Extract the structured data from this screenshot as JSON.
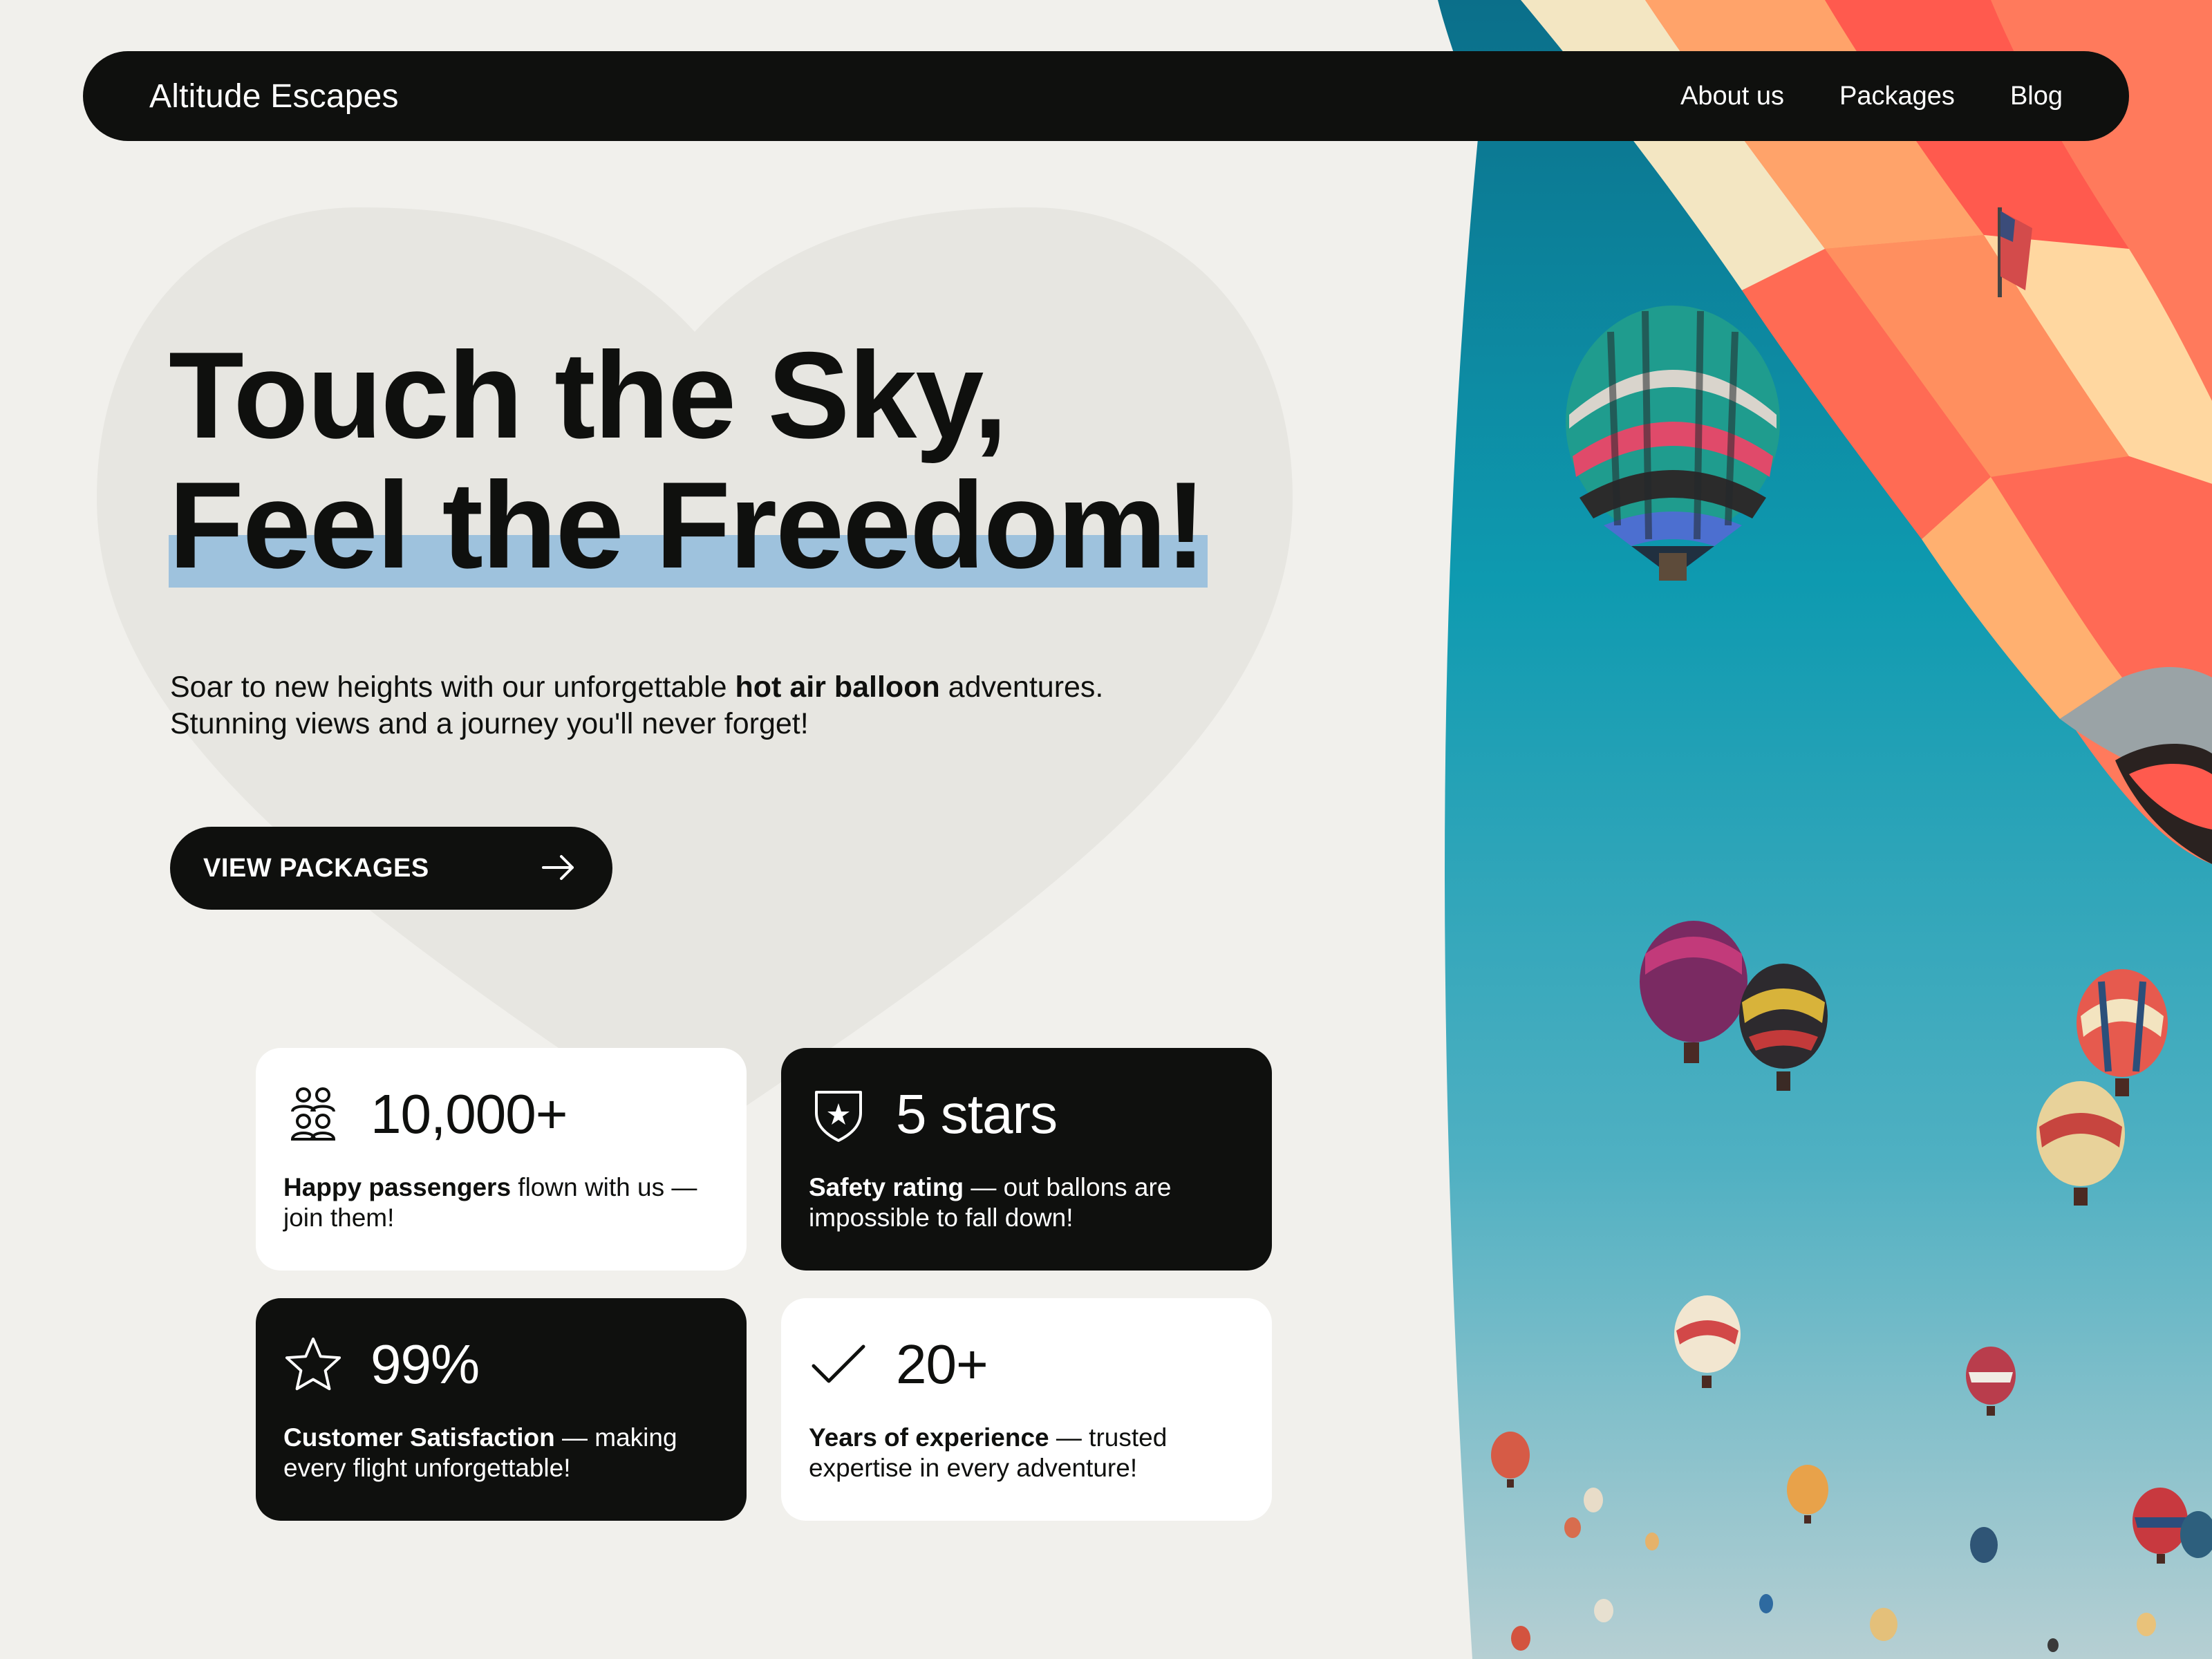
{
  "nav": {
    "brand": "Altitude Escapes",
    "links": [
      "About us",
      "Packages",
      "Blog"
    ]
  },
  "hero": {
    "headline_line1": "Touch the Sky,",
    "headline_line2": "Feel the Freedom!",
    "sub_part1": "Soar to new heights with our unforgettable ",
    "sub_bold": "hot air balloon",
    "sub_part2": " adventures.",
    "sub_line2": "Stunning views and a journey you'll never forget!",
    "cta_label": "VIEW PACKAGES"
  },
  "stats": [
    {
      "icon": "people-icon",
      "value": "10,000+",
      "bold": "Happy passengers",
      "rest": " flown with us — join them!",
      "theme": "light"
    },
    {
      "icon": "shield-star-icon",
      "value": "5 stars",
      "bold": "Safety rating",
      "rest": " — out ballons are impossible to fall down!",
      "theme": "dark"
    },
    {
      "icon": "star-icon",
      "value": "99%",
      "bold": "Customer Satisfaction",
      "rest": " — making every flight unforgettable!",
      "theme": "dark"
    },
    {
      "icon": "check-icon",
      "value": "20+",
      "bold": "Years of experience",
      "rest": " — trusted expertise in every adventure!",
      "theme": "light"
    }
  ],
  "colors": {
    "background": "#f1f0ec",
    "ink": "#0f100e",
    "highlight": "#9ec2dd",
    "heart": "#e7e6e1",
    "sky_top": "#0b7c99",
    "sky_bottom": "#a9cbd2"
  },
  "image": {
    "subject": "hot air balloons in a blue sky"
  }
}
